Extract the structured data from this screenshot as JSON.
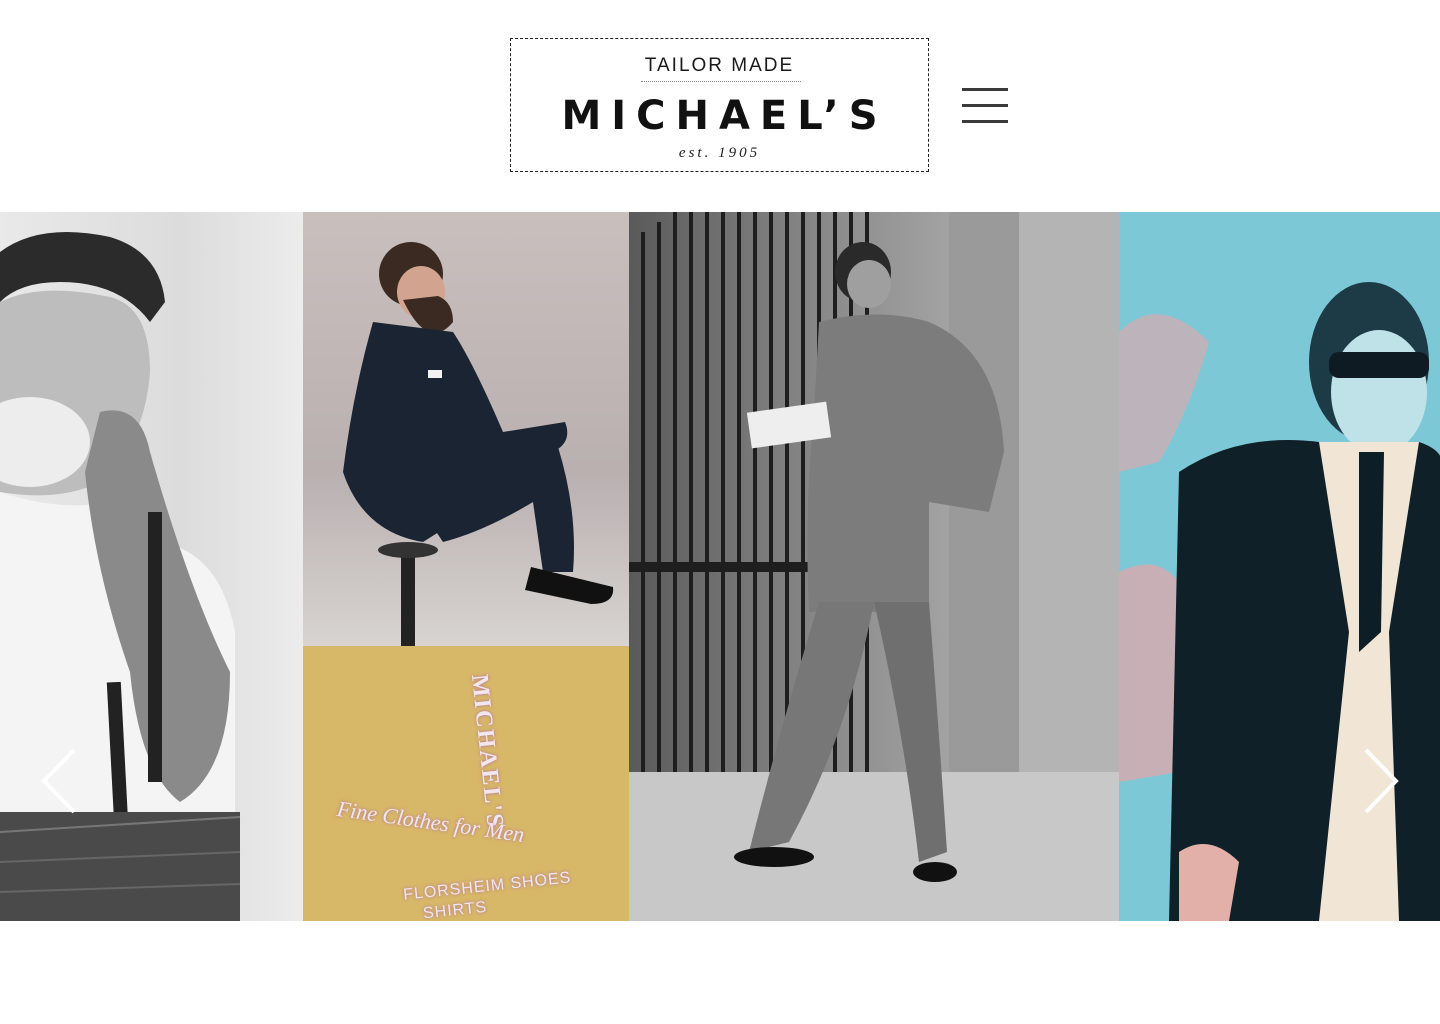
{
  "logo": {
    "top_line": "TAILOR MADE",
    "brand": "MICHAEL’S",
    "established": "est. 1905"
  },
  "header": {
    "menu_icon": "hamburger-menu-icon"
  },
  "gallery": {
    "sign": {
      "brand": "MICHAEL'S",
      "slogan": "Fine Clothes for Men",
      "line1": "FLORSHEIM SHOES",
      "line2": "SHIRTS"
    },
    "prev_icon": "chevron-left-icon",
    "next_icon": "chevron-right-icon"
  },
  "colors": {
    "background": "#ffffff",
    "text": "#111111",
    "sign_yellow": "#d7b768",
    "cyan_tile": "#7cc8d6"
  }
}
